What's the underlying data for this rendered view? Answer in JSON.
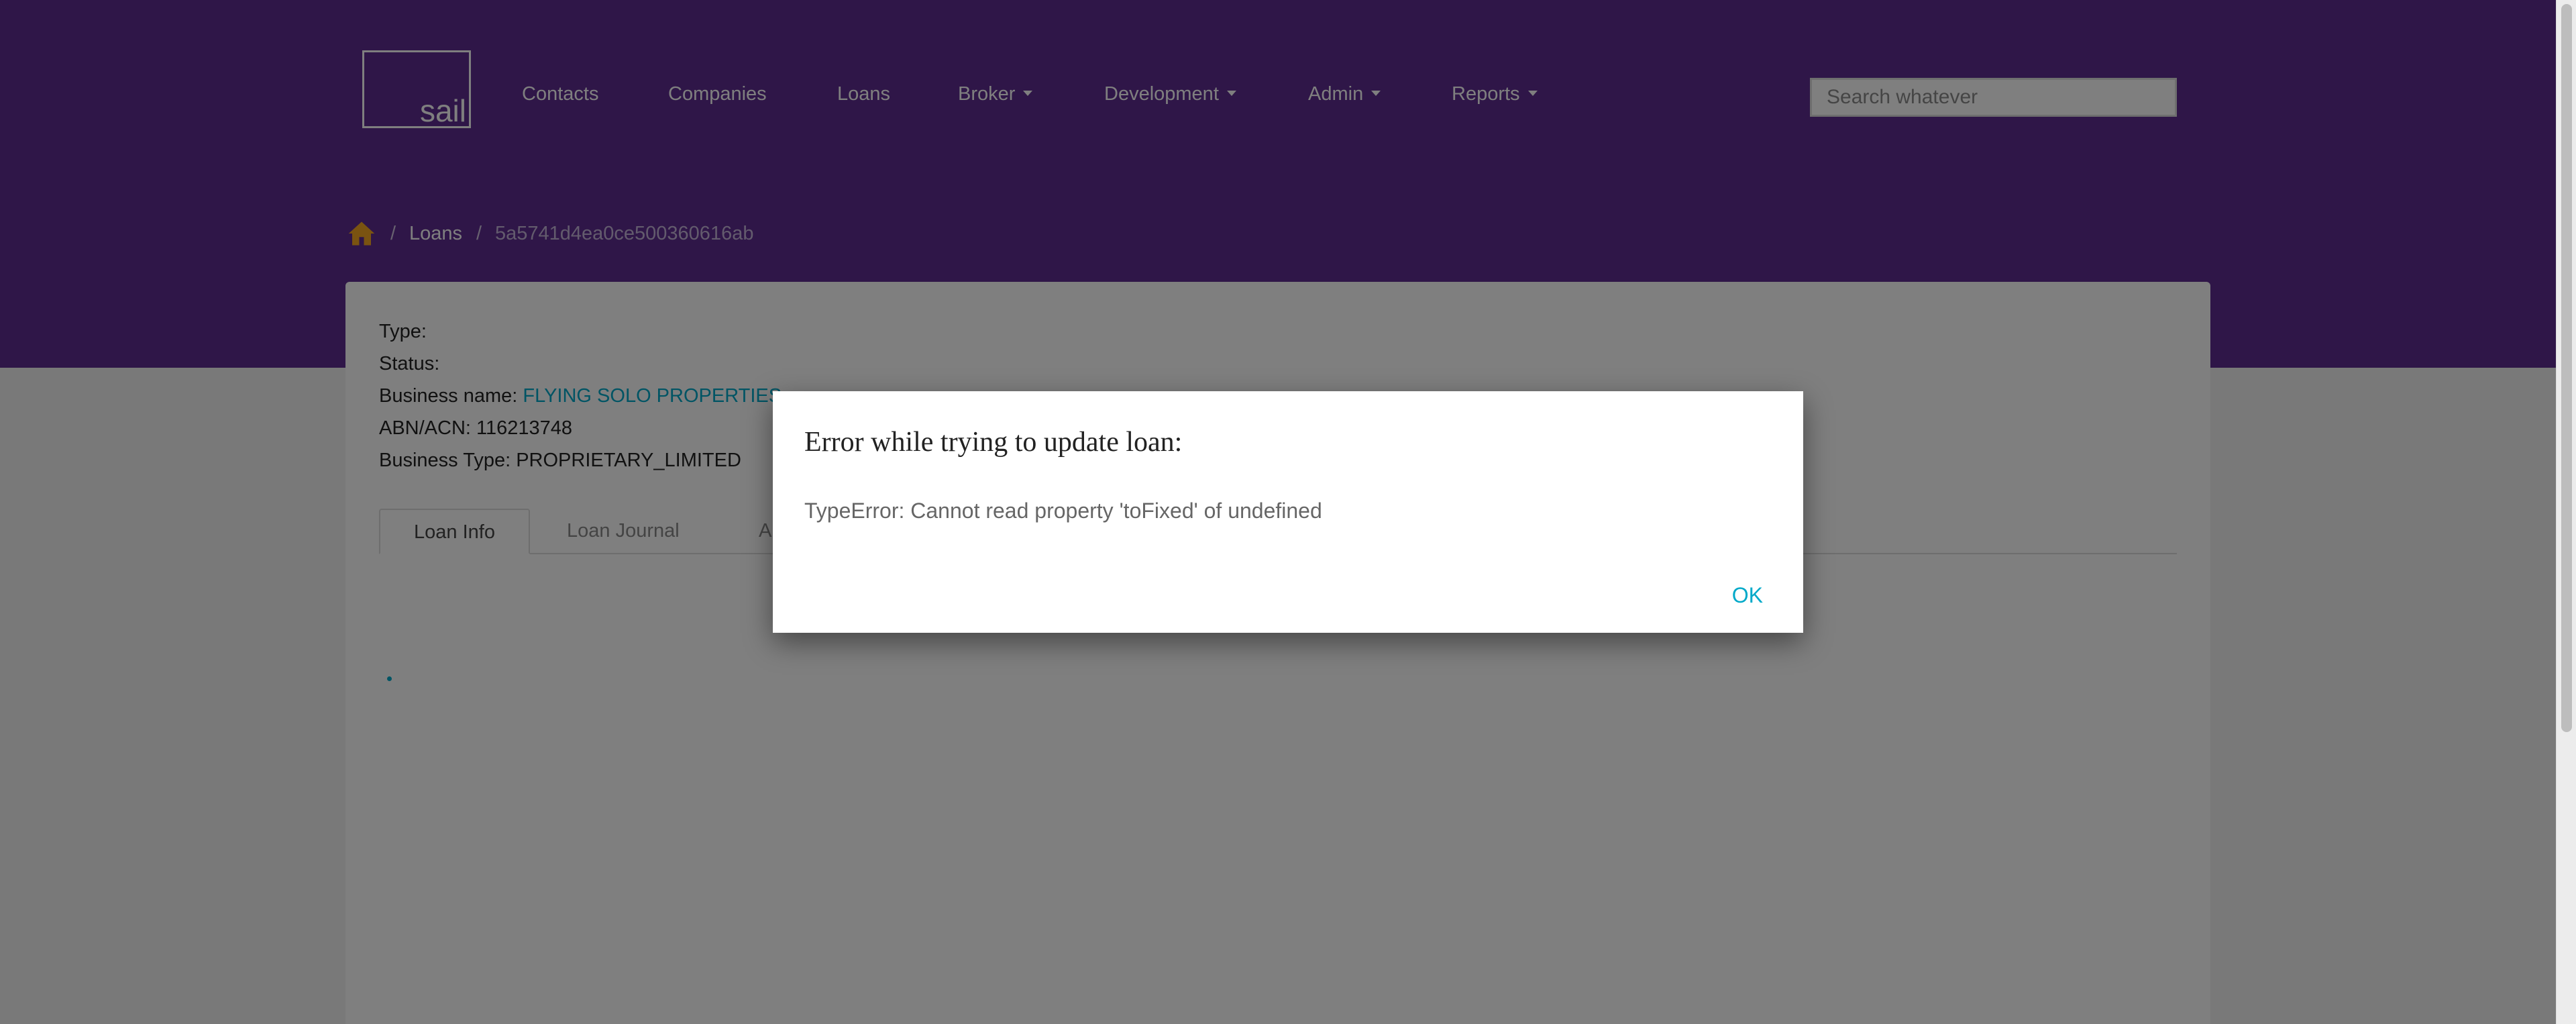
{
  "logo": {
    "text": "sail"
  },
  "nav": {
    "contacts": "Contacts",
    "companies": "Companies",
    "loans": "Loans",
    "broker": "Broker",
    "development": "Development",
    "admin": "Admin",
    "reports": "Reports"
  },
  "search": {
    "placeholder": "Search whatever",
    "value": ""
  },
  "breadcrumb": {
    "separator": "/",
    "loans": "Loans",
    "current": "5a5741d4ea0ce500360616ab"
  },
  "loan": {
    "type_label": "Type:",
    "type_value": "",
    "status_label": "Status:",
    "status_value": "",
    "business_name_label": "Business name:",
    "business_name_value": "FLYING SOLO PROPERTIES",
    "abn_label": "ABN/ACN:",
    "abn_value": "116213748",
    "business_type_label": "Business Type:",
    "business_type_value": "PROPRIETARY_LIMITED"
  },
  "tabs": [
    {
      "label": "Loan Info",
      "active": true
    },
    {
      "label": "Loan Journal",
      "active": false
    },
    {
      "label": "A",
      "active": false
    }
  ],
  "dialog": {
    "title": "Error while trying to update loan:",
    "message": "TypeError: Cannot read property 'toFixed' of undefined",
    "ok_label": "OK"
  },
  "colors": {
    "header_purple": "#5e2d91",
    "accent_teal": "#00a9c9",
    "home_icon": "#f5a623"
  }
}
